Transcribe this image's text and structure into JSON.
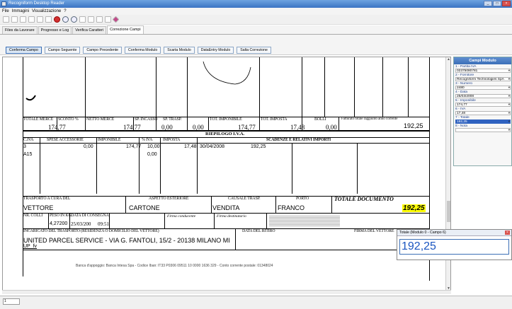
{
  "window": {
    "title": "Recogniform Desktop Reader"
  },
  "menu": [
    "File",
    "Immagini",
    "Visualizzazione",
    "?"
  ],
  "tabs": [
    "Files da Lavorare",
    "Progresso e Log",
    "Verifica Caratteri",
    "Correzione Campi"
  ],
  "active_tab": "Correzione Campi",
  "actions": [
    "Conferma Campo",
    "Campo Seguente",
    "Campo Precedente",
    "Conferma Modulo",
    "Scarta Modulo",
    "DataEntry Modulo",
    "Salta Correzione"
  ],
  "doc": {
    "totals_headers": [
      "TOTALE MERCE",
      "SCONTO %",
      "NETTO MERCE",
      "SP. INCASSO",
      "SP. TRASP.",
      "TOT. IMPONIBILE",
      "TOT. IMPOSTA",
      "BOLLI",
      "Fatturato totale raggiunto anno corrente"
    ],
    "totals_values": [
      "174,77",
      "174,77",
      "0,00",
      "0,00",
      "174,77",
      "17,48",
      "0,00",
      "192,25"
    ],
    "riepilogo_title": "RIEPILOGO I.V.A.",
    "riepilogo_headers": [
      "C.IVA",
      "SPESE ACCESSORIE",
      "IMPONIBILE",
      "% IVA",
      "IMPOSTA",
      "SCADENZE E RELATIVI IMPORTI"
    ],
    "riepilogo_row1": {
      "civa": "3",
      "spese": "0,00",
      "imponibile": "174,77",
      "iva": "10,00",
      "imposta": "17,48",
      "data": "30/04/2008",
      "importo": "192,25"
    },
    "riepilogo_row2": {
      "civa": "A15",
      "iva": "0,00"
    },
    "transport_headers": [
      "TRASPORTO A CURA DEL",
      "ASPETTO ESTERIORE",
      "CAUSALE TRASP.",
      "PORTO",
      "TOTALE DOCUMENTO"
    ],
    "transport_values": [
      "VETTORE",
      "CARTONE",
      "VENDITA",
      "FRANCO",
      "192,25"
    ],
    "colli_headers": [
      "NR. COLLI",
      "PESO IN KG.",
      "DATA DI CONSEGNA",
      "Firma conducente",
      "Firma destinatario"
    ],
    "colli_values": [
      "4,27200",
      "25/03/200",
      "09:51"
    ],
    "incaricato_header": "INCARICATO DEL TRASPORTO (RESIDENZA O DOMICILIO DEL VETTORE)",
    "data_ritiro": "DATA DEL RITIRO",
    "firma_vettore": "FIRMA DEL VETTORE",
    "incaricato_value": "UNITED PARCEL SERVICE  -  VIA G. FANTOLI, 15/2  -  20138 MILANO  MI",
    "ups_line2": "UP_fv",
    "bank_line": "Banca d'appoggio: Banca Intesa Spa - Codice Iban: IT33 P0306 09511 10 0000 1636 329 - Conto corrente postale: 01348024"
  },
  "panel": {
    "title": "Campi Modulo",
    "fields": [
      {
        "label": "1 - Partita IVA",
        "value": "02375080781"
      },
      {
        "label": "2 - Fornitore",
        "value": "Recogniform Technologies SpA"
      },
      {
        "label": "3 - Numero",
        "value": "2480"
      },
      {
        "label": "4 - Data",
        "value": "25/03/2008"
      },
      {
        "label": "5 - Imponibile",
        "value": "174,77"
      },
      {
        "label": "6 - IVA",
        "value": "17,48"
      },
      {
        "label": "7 - Totale",
        "value": "192,25"
      },
      {
        "label": "8 - Nota",
        "value": ""
      }
    ]
  },
  "popup": {
    "title": "Totale (Modulo 0 - Campo 6)",
    "value": "192,25"
  },
  "status": {
    "cell": "1"
  }
}
